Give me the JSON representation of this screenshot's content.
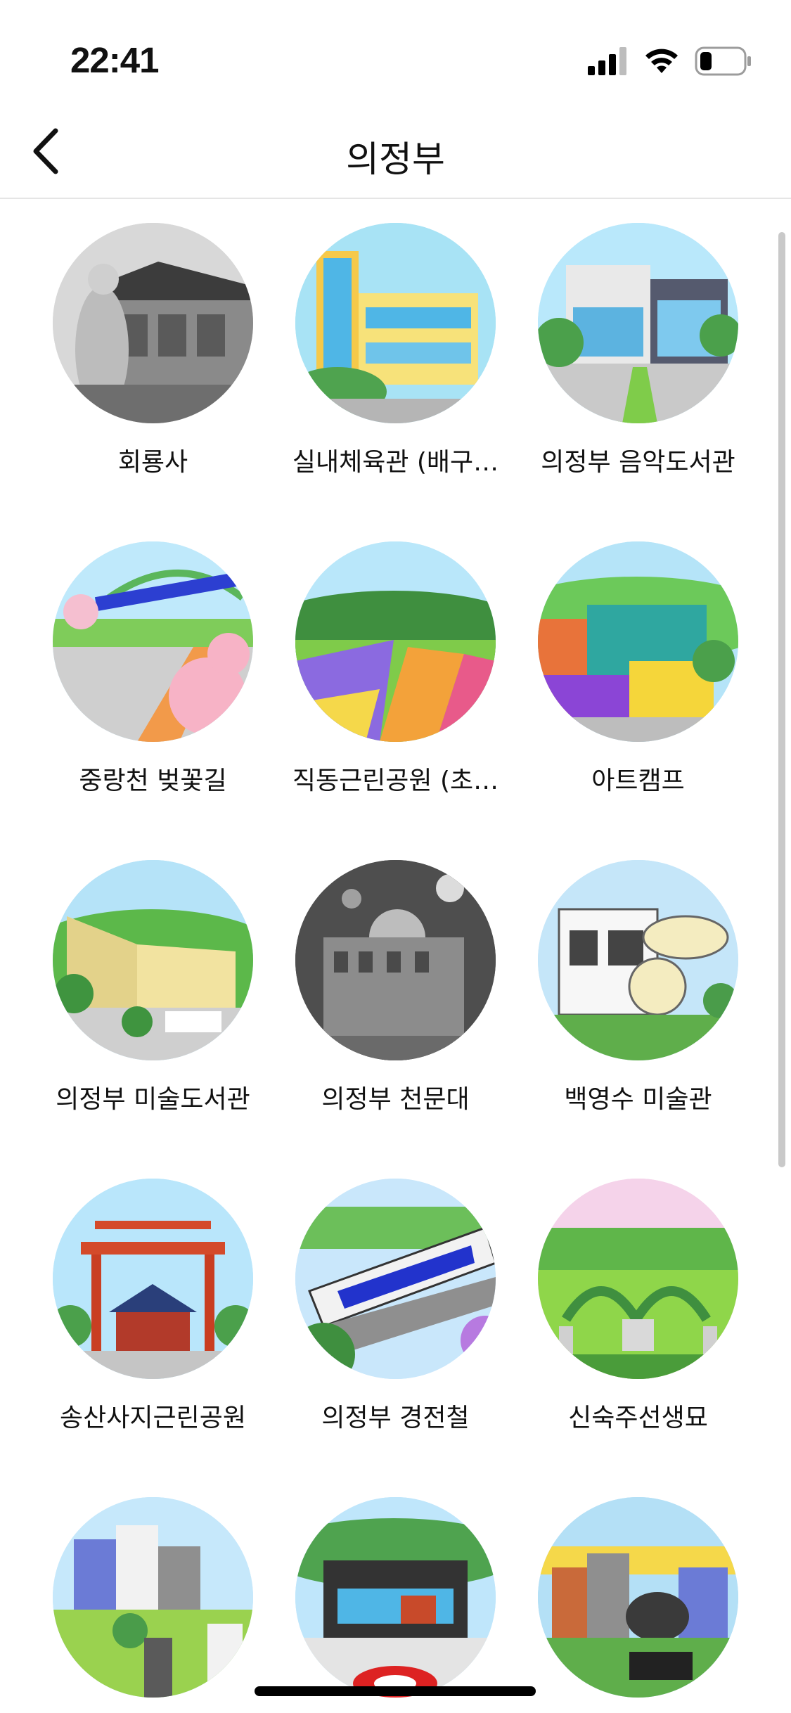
{
  "status_bar": {
    "time": "22:41",
    "signal_icon": "cellular-signal-icon",
    "wifi_icon": "wifi-icon",
    "battery_icon": "battery-icon"
  },
  "nav": {
    "title": "의정부",
    "back_icon": "chevron-left-icon"
  },
  "places": [
    {
      "label": "회룡사",
      "bg": "#dcdcdc"
    },
    {
      "label": "실내체육관 (배구…",
      "bg": "#a8e3f5"
    },
    {
      "label": "의정부 음악도서관",
      "bg": "#b9e8fb"
    },
    {
      "label": "중랑천 벚꽃길",
      "bg": "#bfe9fb"
    },
    {
      "label": "직동근린공원 (초…",
      "bg": "#b9e7fa"
    },
    {
      "label": "아트캠프",
      "bg": "#b5e4f8"
    },
    {
      "label": "의정부 미술도서관",
      "bg": "#b5e3f8"
    },
    {
      "label": "의정부 천문대",
      "bg": "#5a5a5a"
    },
    {
      "label": "백영수 미술관",
      "bg": "#c5e6f9"
    },
    {
      "label": "송산사지근린공원",
      "bg": "#b9e6fb"
    },
    {
      "label": "의정부 경전철",
      "bg": "#c9e7fb"
    },
    {
      "label": "신숙주선생묘",
      "bg": "#f5d3ea"
    },
    {
      "label": "",
      "bg": "#c6e8fb"
    },
    {
      "label": "",
      "bg": "#bfe6fb"
    },
    {
      "label": "",
      "bg": "#b4e0f6"
    }
  ]
}
